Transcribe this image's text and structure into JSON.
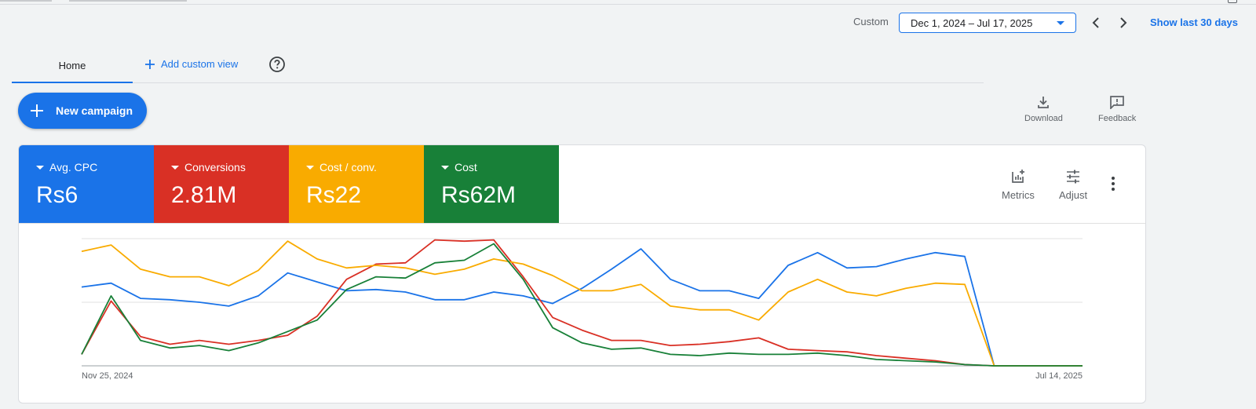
{
  "header": {
    "date_label": "Custom",
    "date_range": "Dec 1, 2024 – Jul 17, 2025",
    "show_last": "Show last 30 days"
  },
  "tabs": {
    "home": "Home",
    "add_view": "Add custom view"
  },
  "actions": {
    "new_campaign": "New campaign",
    "download": "Download",
    "feedback": "Feedback"
  },
  "metrics": [
    {
      "label": "Avg. CPC",
      "value": "Rs6",
      "color": "#1a73e8"
    },
    {
      "label": "Conversions",
      "value": "2.81M",
      "color": "#d93025"
    },
    {
      "label": "Cost / conv.",
      "value": "Rs22",
      "color": "#f9ab00"
    },
    {
      "label": "Cost",
      "value": "Rs62M",
      "color": "#188038"
    }
  ],
  "card_tools": {
    "metrics": "Metrics",
    "adjust": "Adjust"
  },
  "chart_data": {
    "type": "line",
    "x_start_label": "Nov 25, 2024",
    "x_end_label": "Jul 14, 2025",
    "grid": true,
    "series": [
      {
        "color": "#1a73e8",
        "values": [
          62,
          65,
          53,
          52,
          50,
          47,
          55,
          73,
          66,
          59,
          60,
          58,
          52,
          52,
          58,
          55,
          49,
          61,
          76,
          92,
          68,
          59,
          59,
          53,
          79,
          89,
          77,
          78,
          84,
          89,
          86,
          0,
          0,
          0,
          0
        ]
      },
      {
        "color": "#d93025",
        "values": [
          9,
          51,
          23,
          17,
          20,
          17,
          20,
          24,
          39,
          68,
          80,
          81,
          99,
          98,
          99,
          70,
          38,
          28,
          20,
          20,
          16,
          17,
          19,
          22,
          13,
          12,
          11,
          8,
          6,
          4,
          1,
          0,
          0,
          0,
          0
        ]
      },
      {
        "color": "#f9ab00",
        "values": [
          90,
          95,
          76,
          70,
          70,
          63,
          75,
          98,
          84,
          77,
          79,
          77,
          72,
          76,
          84,
          80,
          71,
          59,
          59,
          64,
          47,
          44,
          44,
          36,
          58,
          68,
          58,
          55,
          61,
          65,
          64,
          0,
          0,
          0,
          0
        ]
      },
      {
        "color": "#188038",
        "values": [
          9,
          55,
          20,
          14,
          16,
          12,
          18,
          27,
          36,
          60,
          70,
          69,
          81,
          83,
          96,
          68,
          30,
          18,
          13,
          14,
          9,
          8,
          10,
          9,
          9,
          10,
          8,
          5,
          4,
          3,
          1,
          0,
          0,
          0,
          0
        ]
      }
    ]
  }
}
